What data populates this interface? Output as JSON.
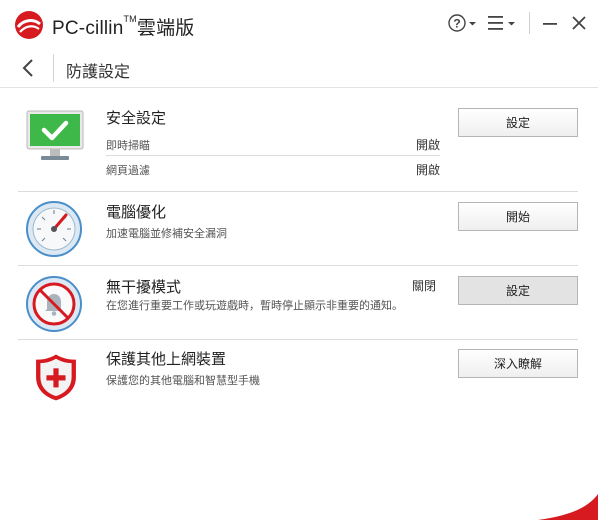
{
  "app": {
    "name": "PC-cillin",
    "trademark": "TM",
    "suffix": "雲端版",
    "brand_color": "#d71920"
  },
  "titlebar": {
    "help_icon": "question-circle-icon",
    "menu_icon": "hamburger-menu-icon",
    "minimize_icon": "minimize-icon",
    "close_icon": "close-icon"
  },
  "nav": {
    "back_icon": "chevron-left-icon",
    "page_title": "防護設定"
  },
  "sections": [
    {
      "icon": "monitor-check-icon",
      "title": "安全設定",
      "rows": [
        {
          "label": "即時掃瞄",
          "status": "開啟"
        },
        {
          "label": "網頁過濾",
          "status": "開啟"
        }
      ],
      "button": "設定"
    },
    {
      "icon": "speedometer-icon",
      "title": "電腦優化",
      "desc": "加速電腦並修補安全漏洞",
      "button": "開始"
    },
    {
      "icon": "bell-muted-icon",
      "title": "無干擾模式",
      "status": "關閉",
      "desc": "在您進行重要工作或玩遊戲時，暫時停止顯示非重要的通知。",
      "button": "設定"
    },
    {
      "icon": "shield-plus-icon",
      "title": "保護其他上網裝置",
      "desc": "保護您的其他電腦和智慧型手機",
      "button": "深入瞭解"
    }
  ],
  "colors": {
    "check_green": "#3fb84a",
    "accent_red": "#d71920",
    "gauge_blue": "#4a8fc9"
  }
}
